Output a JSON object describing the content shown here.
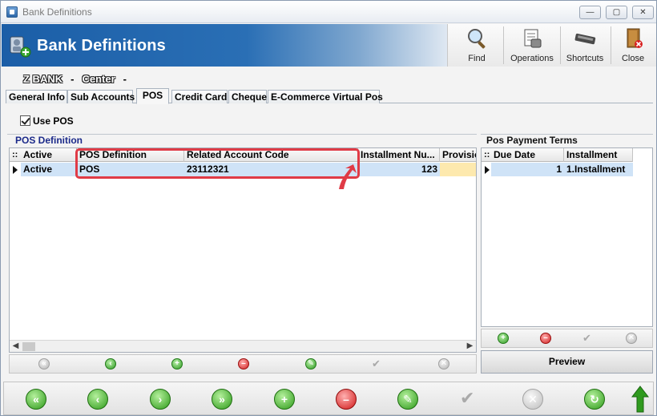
{
  "window": {
    "title": "Bank Definitions",
    "minimize": "—",
    "maximize": "▢",
    "close": "✕"
  },
  "header": {
    "title": "Bank Definitions"
  },
  "toolbar": {
    "find": "Find",
    "operations": "Operations",
    "shortcuts": "Shortcuts",
    "close": "Close"
  },
  "company": {
    "name": "Z BANK",
    "separator": "-",
    "branch": "Center",
    "trailing": "-"
  },
  "tabs": [
    {
      "label": "General Info"
    },
    {
      "label": "Sub Accounts"
    },
    {
      "label": "POS"
    },
    {
      "label": "Credit Card"
    },
    {
      "label": "Cheque"
    },
    {
      "label": "E-Commerce Virtual Pos"
    }
  ],
  "use_pos": {
    "label": "Use POS",
    "checked": true
  },
  "pos_definition": {
    "title": "POS Definition",
    "columns": [
      "Active",
      "POS Definition",
      "Related Account Code",
      "Installment Nu...",
      "Provisio"
    ],
    "rows": [
      {
        "active": "Active",
        "pos_definition": "POS",
        "related_account_code": "23112321",
        "installment_number": "123",
        "provision": ""
      }
    ]
  },
  "pos_payment_terms": {
    "title": "Pos Payment Terms",
    "columns": [
      "Due Date",
      "Installment"
    ],
    "rows": [
      {
        "due_date": "1",
        "installment": "1.Installment"
      }
    ]
  },
  "preview_label": "Preview",
  "colors": {
    "header_blue": "#1b5ea7",
    "selected_row": "#cfe3f7",
    "provision_cell": "#fde9ae",
    "highlight": "#e03b46"
  }
}
